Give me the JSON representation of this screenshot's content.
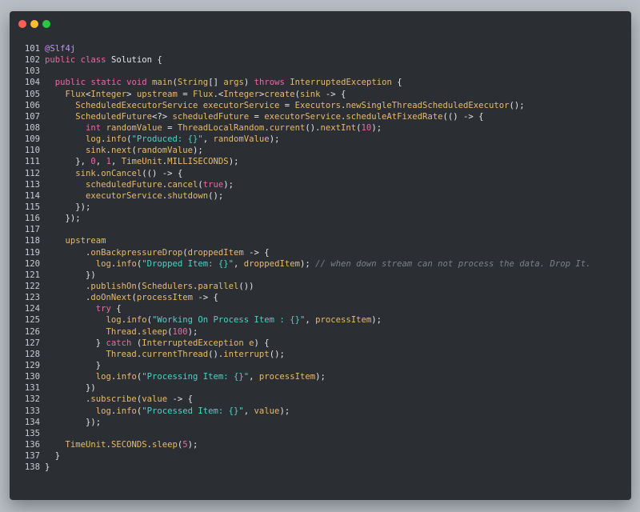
{
  "window": {
    "buttons": [
      "close",
      "minimize",
      "maximize"
    ],
    "colors": {
      "background": "#2b2f34",
      "page": "#b8bec5"
    }
  },
  "code": {
    "lines": [
      {
        "num": "101",
        "tokens": [
          [
            "a",
            "@Slf4j"
          ]
        ]
      },
      {
        "num": "102",
        "tokens": [
          [
            "k",
            "public"
          ],
          [
            "p",
            " "
          ],
          [
            "k",
            "class"
          ],
          [
            "p",
            " Solution {"
          ]
        ]
      },
      {
        "num": "103",
        "tokens": []
      },
      {
        "num": "104",
        "tokens": [
          [
            "p",
            "  "
          ],
          [
            "k",
            "public"
          ],
          [
            "p",
            " "
          ],
          [
            "k",
            "static"
          ],
          [
            "p",
            " "
          ],
          [
            "k",
            "void"
          ],
          [
            "p",
            " "
          ],
          [
            "f",
            "main"
          ],
          [
            "p",
            "("
          ],
          [
            "t",
            "String"
          ],
          [
            "p",
            "[] "
          ],
          [
            "t",
            "args"
          ],
          [
            "p",
            ") "
          ],
          [
            "k",
            "throws"
          ],
          [
            "p",
            " "
          ],
          [
            "t",
            "InterruptedException"
          ],
          [
            "p",
            " {"
          ]
        ]
      },
      {
        "num": "105",
        "tokens": [
          [
            "p",
            "    "
          ],
          [
            "t",
            "Flux"
          ],
          [
            "p",
            "<"
          ],
          [
            "t",
            "Integer"
          ],
          [
            "p",
            "> "
          ],
          [
            "t",
            "upstream"
          ],
          [
            "p",
            " = "
          ],
          [
            "t",
            "Flux"
          ],
          [
            "p",
            ".<"
          ],
          [
            "t",
            "Integer"
          ],
          [
            "p",
            ">"
          ],
          [
            "f",
            "create"
          ],
          [
            "p",
            "("
          ],
          [
            "t",
            "sink"
          ],
          [
            "p",
            " -> {"
          ]
        ]
      },
      {
        "num": "106",
        "tokens": [
          [
            "p",
            "      "
          ],
          [
            "t",
            "ScheduledExecutorService"
          ],
          [
            "p",
            " "
          ],
          [
            "t",
            "executorService"
          ],
          [
            "p",
            " = "
          ],
          [
            "t",
            "Executors"
          ],
          [
            "p",
            "."
          ],
          [
            "f",
            "newSingleThreadScheduledExecutor"
          ],
          [
            "p",
            "();"
          ]
        ]
      },
      {
        "num": "107",
        "tokens": [
          [
            "p",
            "      "
          ],
          [
            "t",
            "ScheduledFuture"
          ],
          [
            "p",
            "<?> "
          ],
          [
            "t",
            "scheduledFuture"
          ],
          [
            "p",
            " = "
          ],
          [
            "t",
            "executorService"
          ],
          [
            "p",
            "."
          ],
          [
            "f",
            "scheduleAtFixedRate"
          ],
          [
            "p",
            "(() -> {"
          ]
        ]
      },
      {
        "num": "108",
        "tokens": [
          [
            "p",
            "        "
          ],
          [
            "k",
            "int"
          ],
          [
            "p",
            " "
          ],
          [
            "t",
            "randomValue"
          ],
          [
            "p",
            " = "
          ],
          [
            "t",
            "ThreadLocalRandom"
          ],
          [
            "p",
            "."
          ],
          [
            "f",
            "current"
          ],
          [
            "p",
            "()."
          ],
          [
            "f",
            "nextInt"
          ],
          [
            "p",
            "("
          ],
          [
            "n",
            "10"
          ],
          [
            "p",
            ");"
          ]
        ]
      },
      {
        "num": "109",
        "tokens": [
          [
            "p",
            "        "
          ],
          [
            "t",
            "log"
          ],
          [
            "p",
            "."
          ],
          [
            "f",
            "info"
          ],
          [
            "p",
            "("
          ],
          [
            "s",
            "\"Produced: {}\""
          ],
          [
            "p",
            ", "
          ],
          [
            "t",
            "randomValue"
          ],
          [
            "p",
            ");"
          ]
        ]
      },
      {
        "num": "110",
        "tokens": [
          [
            "p",
            "        "
          ],
          [
            "t",
            "sink"
          ],
          [
            "p",
            "."
          ],
          [
            "f",
            "next"
          ],
          [
            "p",
            "("
          ],
          [
            "t",
            "randomValue"
          ],
          [
            "p",
            ");"
          ]
        ]
      },
      {
        "num": "111",
        "tokens": [
          [
            "p",
            "      }, "
          ],
          [
            "n",
            "0"
          ],
          [
            "p",
            ", "
          ],
          [
            "n",
            "1"
          ],
          [
            "p",
            ", "
          ],
          [
            "t",
            "TimeUnit"
          ],
          [
            "p",
            "."
          ],
          [
            "t",
            "MILLISECONDS"
          ],
          [
            "p",
            ");"
          ]
        ]
      },
      {
        "num": "112",
        "tokens": [
          [
            "p",
            "      "
          ],
          [
            "t",
            "sink"
          ],
          [
            "p",
            "."
          ],
          [
            "f",
            "onCancel"
          ],
          [
            "p",
            "(() -> {"
          ]
        ]
      },
      {
        "num": "113",
        "tokens": [
          [
            "p",
            "        "
          ],
          [
            "t",
            "scheduledFuture"
          ],
          [
            "p",
            "."
          ],
          [
            "f",
            "cancel"
          ],
          [
            "p",
            "("
          ],
          [
            "n",
            "true"
          ],
          [
            "p",
            ");"
          ]
        ]
      },
      {
        "num": "114",
        "tokens": [
          [
            "p",
            "        "
          ],
          [
            "t",
            "executorService"
          ],
          [
            "p",
            "."
          ],
          [
            "f",
            "shutdown"
          ],
          [
            "p",
            "();"
          ]
        ]
      },
      {
        "num": "115",
        "tokens": [
          [
            "p",
            "      });"
          ]
        ]
      },
      {
        "num": "116",
        "tokens": [
          [
            "p",
            "    });"
          ]
        ]
      },
      {
        "num": "117",
        "tokens": []
      },
      {
        "num": "118",
        "tokens": [
          [
            "p",
            "    "
          ],
          [
            "t",
            "upstream"
          ]
        ]
      },
      {
        "num": "119",
        "tokens": [
          [
            "p",
            "        ."
          ],
          [
            "f",
            "onBackpressureDrop"
          ],
          [
            "p",
            "("
          ],
          [
            "t",
            "droppedItem"
          ],
          [
            "p",
            " -> {"
          ]
        ]
      },
      {
        "num": "120",
        "tokens": [
          [
            "p",
            "          "
          ],
          [
            "t",
            "log"
          ],
          [
            "p",
            "."
          ],
          [
            "f",
            "info"
          ],
          [
            "p",
            "("
          ],
          [
            "s",
            "\"Dropped Item: {}\""
          ],
          [
            "p",
            ", "
          ],
          [
            "t",
            "droppedItem"
          ],
          [
            "p",
            "); "
          ],
          [
            "c",
            "// when down stream can not process the data. Drop It."
          ]
        ]
      },
      {
        "num": "121",
        "tokens": [
          [
            "p",
            "        })"
          ]
        ]
      },
      {
        "num": "122",
        "tokens": [
          [
            "p",
            "        ."
          ],
          [
            "f",
            "publishOn"
          ],
          [
            "p",
            "("
          ],
          [
            "t",
            "Schedulers"
          ],
          [
            "p",
            "."
          ],
          [
            "f",
            "parallel"
          ],
          [
            "p",
            "())"
          ]
        ]
      },
      {
        "num": "123",
        "tokens": [
          [
            "p",
            "        ."
          ],
          [
            "f",
            "doOnNext"
          ],
          [
            "p",
            "("
          ],
          [
            "t",
            "processItem"
          ],
          [
            "p",
            " -> {"
          ]
        ]
      },
      {
        "num": "124",
        "tokens": [
          [
            "p",
            "          "
          ],
          [
            "k",
            "try"
          ],
          [
            "p",
            " {"
          ]
        ]
      },
      {
        "num": "125",
        "tokens": [
          [
            "p",
            "            "
          ],
          [
            "t",
            "log"
          ],
          [
            "p",
            "."
          ],
          [
            "f",
            "info"
          ],
          [
            "p",
            "("
          ],
          [
            "s",
            "\"Working On Process Item : {}\""
          ],
          [
            "p",
            ", "
          ],
          [
            "t",
            "processItem"
          ],
          [
            "p",
            ");"
          ]
        ]
      },
      {
        "num": "126",
        "tokens": [
          [
            "p",
            "            "
          ],
          [
            "t",
            "Thread"
          ],
          [
            "p",
            "."
          ],
          [
            "f",
            "sleep"
          ],
          [
            "p",
            "("
          ],
          [
            "n",
            "100"
          ],
          [
            "p",
            ");"
          ]
        ]
      },
      {
        "num": "127",
        "tokens": [
          [
            "p",
            "          } "
          ],
          [
            "k",
            "catch"
          ],
          [
            "p",
            " ("
          ],
          [
            "t",
            "InterruptedException"
          ],
          [
            "p",
            " "
          ],
          [
            "t",
            "e"
          ],
          [
            "p",
            ") {"
          ]
        ]
      },
      {
        "num": "128",
        "tokens": [
          [
            "p",
            "            "
          ],
          [
            "t",
            "Thread"
          ],
          [
            "p",
            "."
          ],
          [
            "f",
            "currentThread"
          ],
          [
            "p",
            "()."
          ],
          [
            "f",
            "interrupt"
          ],
          [
            "p",
            "();"
          ]
        ]
      },
      {
        "num": "129",
        "tokens": [
          [
            "p",
            "          }"
          ]
        ]
      },
      {
        "num": "130",
        "tokens": [
          [
            "p",
            "          "
          ],
          [
            "t",
            "log"
          ],
          [
            "p",
            "."
          ],
          [
            "f",
            "info"
          ],
          [
            "p",
            "("
          ],
          [
            "s",
            "\"Processing Item: {}\""
          ],
          [
            "p",
            ", "
          ],
          [
            "t",
            "processItem"
          ],
          [
            "p",
            ");"
          ]
        ]
      },
      {
        "num": "131",
        "tokens": [
          [
            "p",
            "        })"
          ]
        ]
      },
      {
        "num": "132",
        "tokens": [
          [
            "p",
            "        ."
          ],
          [
            "f",
            "subscribe"
          ],
          [
            "p",
            "("
          ],
          [
            "t",
            "value"
          ],
          [
            "p",
            " -> {"
          ]
        ]
      },
      {
        "num": "133",
        "tokens": [
          [
            "p",
            "          "
          ],
          [
            "t",
            "log"
          ],
          [
            "p",
            "."
          ],
          [
            "f",
            "info"
          ],
          [
            "p",
            "("
          ],
          [
            "s",
            "\"Processed Item: {}\""
          ],
          [
            "p",
            ", "
          ],
          [
            "t",
            "value"
          ],
          [
            "p",
            ");"
          ]
        ]
      },
      {
        "num": "134",
        "tokens": [
          [
            "p",
            "        });"
          ]
        ]
      },
      {
        "num": "135",
        "tokens": []
      },
      {
        "num": "136",
        "tokens": [
          [
            "p",
            "    "
          ],
          [
            "t",
            "TimeUnit"
          ],
          [
            "p",
            "."
          ],
          [
            "t",
            "SECONDS"
          ],
          [
            "p",
            "."
          ],
          [
            "f",
            "sleep"
          ],
          [
            "p",
            "("
          ],
          [
            "n",
            "5"
          ],
          [
            "p",
            ");"
          ]
        ]
      },
      {
        "num": "137",
        "tokens": [
          [
            "p",
            "  }"
          ]
        ]
      },
      {
        "num": "138",
        "tokens": [
          [
            "p",
            "}"
          ]
        ]
      }
    ]
  }
}
